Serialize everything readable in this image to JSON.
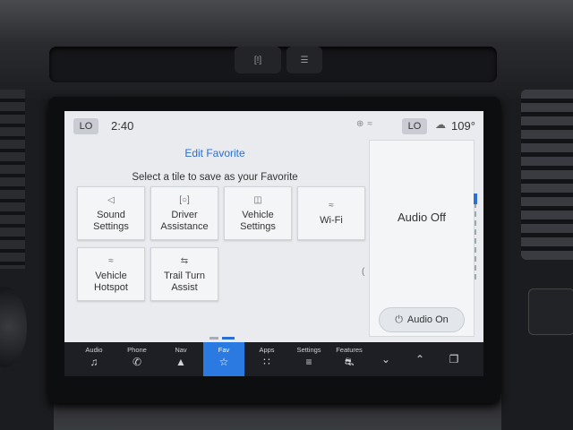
{
  "status_bar": {
    "left_climate": "LO",
    "time": "2:40",
    "right_climate": "LO",
    "temperature": "109°"
  },
  "editor": {
    "heading": "Edit Favorite",
    "instruction": "Select a tile to save as your Favorite"
  },
  "tiles": [
    {
      "label_line1": "Sound",
      "label_line2": "Settings",
      "icon": "speaker-icon"
    },
    {
      "label_line1": "Driver",
      "label_line2": "Assistance",
      "icon": "driver-assist-icon"
    },
    {
      "label_line1": "Vehicle",
      "label_line2": "Settings",
      "icon": "vehicle-settings-icon"
    },
    {
      "label_line1": "Wi-Fi",
      "label_line2": "",
      "icon": "wifi-icon"
    },
    {
      "label_line1": "Vehicle",
      "label_line2": "Hotspot",
      "icon": "hotspot-icon"
    },
    {
      "label_line1": "Trail Turn",
      "label_line2": "Assist",
      "icon": "trail-turn-icon"
    }
  ],
  "audio_panel": {
    "status": "Audio Off",
    "button_label": "Audio On"
  },
  "nav": [
    {
      "label": "Audio",
      "icon": "music-note-icon"
    },
    {
      "label": "Phone",
      "icon": "phone-icon"
    },
    {
      "label": "Nav",
      "icon": "navigation-icon"
    },
    {
      "label": "Fav",
      "icon": "star-icon",
      "active": true
    },
    {
      "label": "Apps",
      "icon": "apps-grid-icon"
    },
    {
      "label": "Settings",
      "icon": "sliders-icon"
    },
    {
      "label": "Features",
      "icon": "truck-icon"
    },
    {
      "label": "",
      "icon": "chevron-down-icon"
    },
    {
      "label": "",
      "icon": "chevron-up-icon"
    },
    {
      "label": "",
      "icon": "screen-layout-icon"
    }
  ],
  "colors": {
    "accent": "#2a7ae2",
    "screen_bg": "#e9ebee",
    "nav_bg": "#1d1f24"
  }
}
